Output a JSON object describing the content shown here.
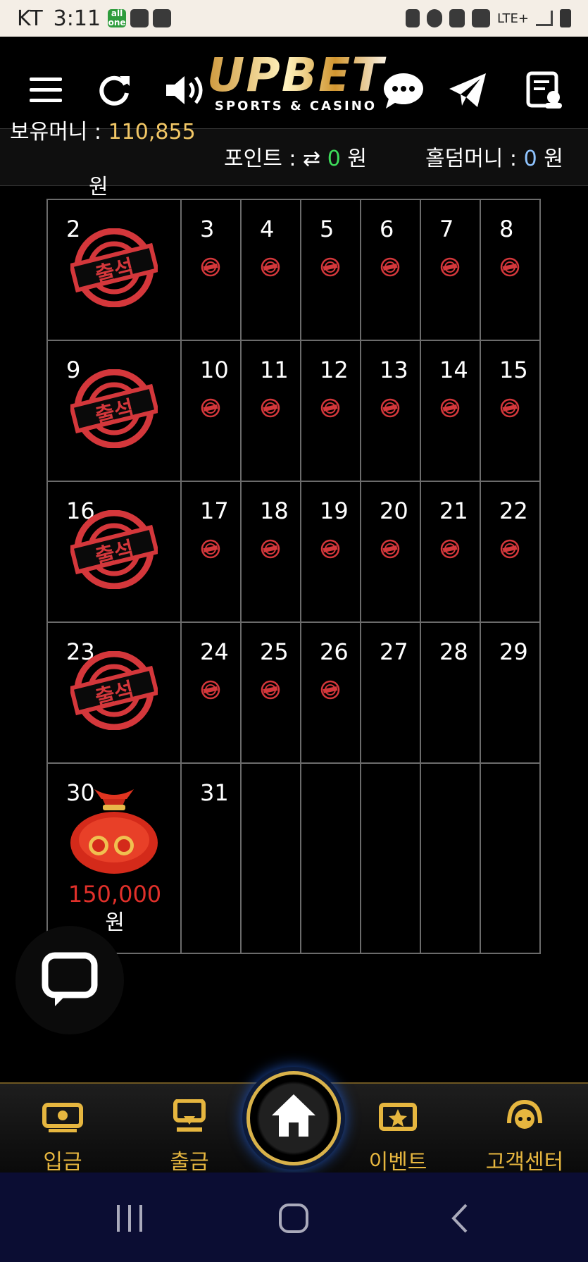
{
  "status_bar": {
    "carrier": "KT",
    "time": "3:11",
    "icon_text": "all one",
    "network": "LTE+"
  },
  "header": {
    "brand": "UPBET",
    "tagline": "SPORTS & CASINO",
    "icons": [
      "menu-icon",
      "refresh-icon",
      "speaker-icon",
      "chat-bubble-icon",
      "telegram-icon",
      "board-icon"
    ]
  },
  "account": {
    "balance_label": "보유머니 :",
    "balance_value": "110,855",
    "won_unit": "원",
    "points_label": "포인트 :",
    "points_value": "0",
    "points_unit": "원",
    "holdem_label": "홀덤머니 :",
    "holdem_value": "0",
    "holdem_unit": "원"
  },
  "calendar": {
    "stamp_text": "출석",
    "weeks": [
      [
        {
          "day": "2",
          "stamp": true
        },
        {
          "day": "3",
          "coin": true
        },
        {
          "day": "4",
          "coin": true
        },
        {
          "day": "5",
          "coin": true
        },
        {
          "day": "6",
          "coin": true
        },
        {
          "day": "7",
          "coin": true
        },
        {
          "day": "8",
          "coin": true
        }
      ],
      [
        {
          "day": "9",
          "stamp": true
        },
        {
          "day": "10",
          "coin": true
        },
        {
          "day": "11",
          "coin": true
        },
        {
          "day": "12",
          "coin": true
        },
        {
          "day": "13",
          "coin": true
        },
        {
          "day": "14",
          "coin": true
        },
        {
          "day": "15",
          "coin": true
        }
      ],
      [
        {
          "day": "16",
          "stamp": true
        },
        {
          "day": "17",
          "coin": true
        },
        {
          "day": "18",
          "coin": true
        },
        {
          "day": "19",
          "coin": true
        },
        {
          "day": "20",
          "coin": true
        },
        {
          "day": "21",
          "coin": true
        },
        {
          "day": "22",
          "coin": true
        }
      ],
      [
        {
          "day": "23",
          "stamp": true
        },
        {
          "day": "24",
          "coin": true
        },
        {
          "day": "25",
          "coin": true
        },
        {
          "day": "26",
          "coin": true
        },
        {
          "day": "27"
        },
        {
          "day": "28"
        },
        {
          "day": "29"
        }
      ],
      [
        {
          "day": "30",
          "bag": true,
          "prize": "150,000",
          "unit": "원"
        },
        {
          "day": "31"
        },
        {
          "day": ""
        },
        {
          "day": ""
        },
        {
          "day": ""
        },
        {
          "day": ""
        },
        {
          "day": ""
        }
      ]
    ]
  },
  "bottom_nav": {
    "deposit": "입금",
    "withdraw": "출금",
    "event": "이벤트",
    "support": "고객센터"
  },
  "colors": {
    "accent_gold": "#e6b63f",
    "balance_gold": "#f2c766",
    "point_green": "#3ddc5a",
    "stamp_red": "#d4373b"
  }
}
